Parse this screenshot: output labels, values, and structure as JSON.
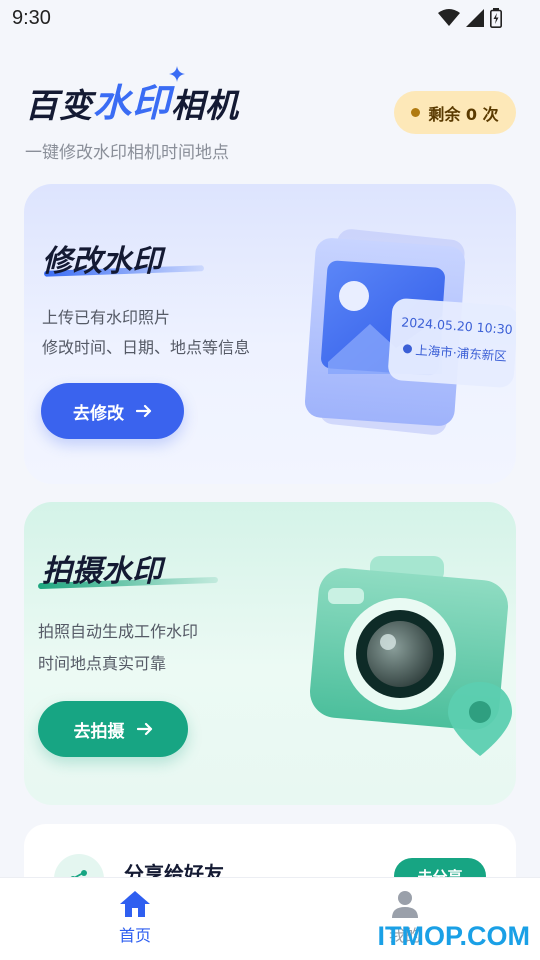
{
  "status_bar": {
    "time": "9:30"
  },
  "header": {
    "title_part1": "百变",
    "title_part2": "水印",
    "title_part3": "相机",
    "subtitle": "一键修改水印相机时间地点",
    "remaining_badge": "剩余 0 次"
  },
  "cards": {
    "edit": {
      "title": "修改水印",
      "desc1": "上传已有水印照片",
      "desc2": "修改时间、日期、地点等信息",
      "button": "去修改",
      "photo_date": "2024.05.20 10:30",
      "photo_location": "上海市·浦东新区"
    },
    "shoot": {
      "title": "拍摄水印",
      "desc1": "拍照自动生成工作水印",
      "desc2": "时间地点真实可靠",
      "button": "去拍摄"
    }
  },
  "share": {
    "title": "分享给好友",
    "button": "去分享"
  },
  "nav": {
    "home": "首页",
    "mine": "我的"
  },
  "watermark": "ITMOP.COM",
  "colors": {
    "accent_blue": "#3a63ee",
    "accent_green": "#17a583",
    "badge_bg": "#fde8b8"
  }
}
